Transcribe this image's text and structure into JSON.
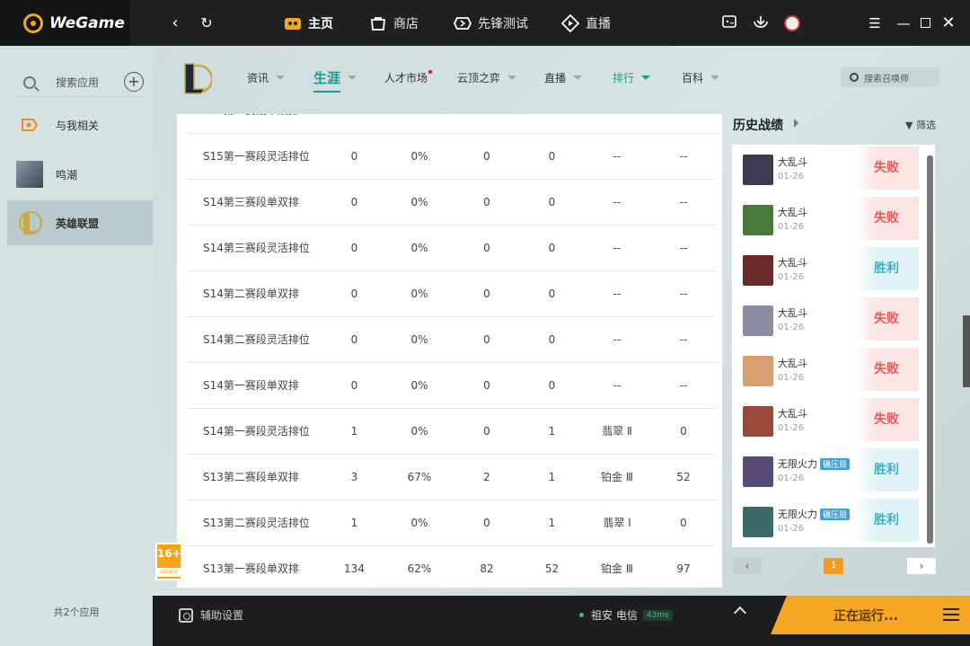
{
  "app": {
    "logo_text": "WeGame"
  },
  "titlebar": {
    "nav": [
      {
        "label": "主页",
        "icon": "home-icon",
        "active": true
      },
      {
        "label": "商店",
        "icon": "store-icon",
        "active": false
      },
      {
        "label": "先锋测试",
        "icon": "pioneer-test-icon",
        "active": false
      },
      {
        "label": "直播",
        "icon": "live-icon",
        "active": false
      }
    ]
  },
  "sidebar": {
    "search_placeholder": "搜索应用",
    "items": [
      {
        "label": "与我相关",
        "icon": "related-icon"
      },
      {
        "label": "鸣潮",
        "icon": "wuthering-waves-avatar"
      },
      {
        "label": "英雄联盟",
        "icon": "lol-logo"
      }
    ],
    "footer": "共2个应用"
  },
  "subnav": [
    {
      "label": "资讯"
    },
    {
      "label": "生涯"
    },
    {
      "label": "人才市场"
    },
    {
      "label": "云顶之弈"
    },
    {
      "label": "直播"
    },
    {
      "label": "排行"
    },
    {
      "label": "百科"
    }
  ],
  "summoner_search_placeholder": "搜索召唤师",
  "table": {
    "rows": [
      [
        "S15第一赛段灵活排位",
        "0",
        "0%",
        "0",
        "0",
        "--",
        "--"
      ],
      [
        "S14第三赛段单双排",
        "0",
        "0%",
        "0",
        "0",
        "--",
        "--"
      ],
      [
        "S14第三赛段灵活排位",
        "0",
        "0%",
        "0",
        "0",
        "--",
        "--"
      ],
      [
        "S14第二赛段单双排",
        "0",
        "0%",
        "0",
        "0",
        "--",
        "--"
      ],
      [
        "S14第二赛段灵活排位",
        "0",
        "0%",
        "0",
        "0",
        "--",
        "--"
      ],
      [
        "S14第一赛段单双排",
        "0",
        "0%",
        "0",
        "0",
        "--",
        "--"
      ],
      [
        "S14第一赛段灵活排位",
        "1",
        "0%",
        "0",
        "1",
        "翡翠 Ⅱ",
        "0"
      ],
      [
        "S13第二赛段单双排",
        "3",
        "67%",
        "2",
        "1",
        "铂金 Ⅲ",
        "52"
      ],
      [
        "S13第二赛段灵活排位",
        "1",
        "0%",
        "0",
        "1",
        "翡翠 Ⅰ",
        "0"
      ],
      [
        "S13第一赛段单双排",
        "134",
        "62%",
        "82",
        "52",
        "铂金 Ⅲ",
        "97"
      ]
    ]
  },
  "history": {
    "title": "历史战绩",
    "filter": "筛选",
    "matches": [
      {
        "mode": "大乱斗",
        "date": "01-26",
        "result": "失败",
        "win": false,
        "tag": "",
        "color": "#3d3a52"
      },
      {
        "mode": "大乱斗",
        "date": "01-26",
        "result": "失败",
        "win": false,
        "tag": "",
        "color": "#4a7a3a"
      },
      {
        "mode": "大乱斗",
        "date": "01-26",
        "result": "胜利",
        "win": true,
        "tag": "",
        "color": "#6a2a2a"
      },
      {
        "mode": "大乱斗",
        "date": "01-26",
        "result": "失败",
        "win": false,
        "tag": "",
        "color": "#8a8aa0"
      },
      {
        "mode": "大乱斗",
        "date": "01-26",
        "result": "失败",
        "win": false,
        "tag": "",
        "color": "#d8a070"
      },
      {
        "mode": "大乱斗",
        "date": "01-26",
        "result": "失败",
        "win": false,
        "tag": "",
        "color": "#9a4a3a"
      },
      {
        "mode": "无限火力",
        "date": "01-26",
        "result": "胜利",
        "win": true,
        "tag": "碾压局",
        "color": "#5a4a7a"
      },
      {
        "mode": "无限火力",
        "date": "01-26",
        "result": "胜利",
        "win": true,
        "tag": "碾压局",
        "color": "#3a6a6a"
      }
    ],
    "page": "1",
    "prev": "‹",
    "next": "›"
  },
  "age_badge": {
    "number": "16+",
    "text": "适龄提示"
  },
  "bottom": {
    "assist": "辅助设置",
    "server": "祖安 电信",
    "ping": "43ms",
    "running": "正在运行..."
  }
}
